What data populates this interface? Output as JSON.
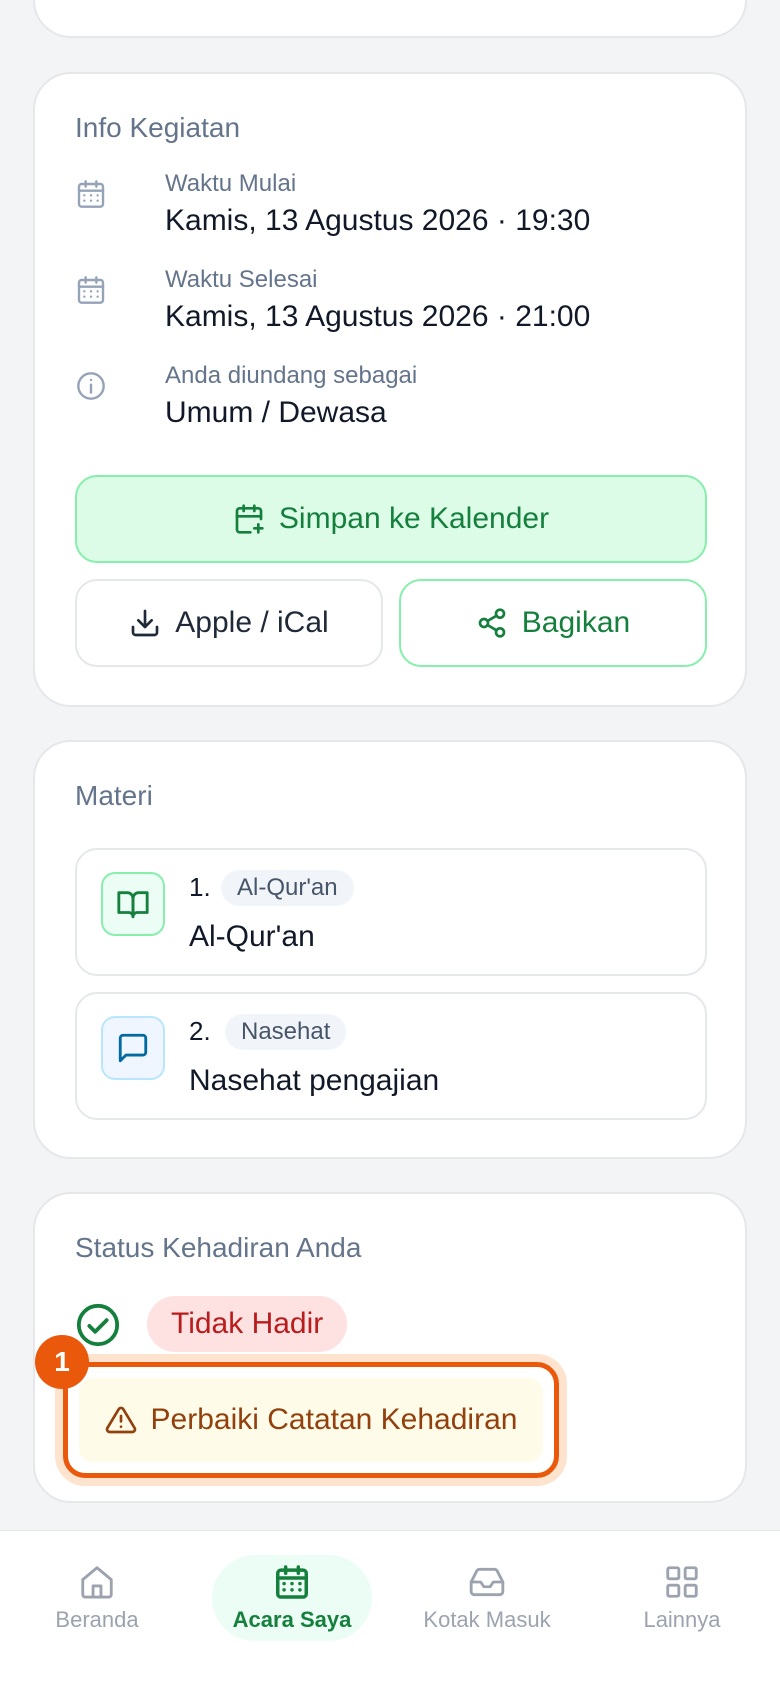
{
  "info": {
    "title": "Info Kegiatan",
    "rows": [
      {
        "label": "Waktu Mulai",
        "value": "Kamis, 13 Agustus 2026 · 19:30",
        "icon": "calendar-icon"
      },
      {
        "label": "Waktu Selesai",
        "value": "Kamis, 13 Agustus 2026 · 21:00",
        "icon": "calendar-icon"
      },
      {
        "label": "Anda diundang sebagai",
        "value": "Umum / Dewasa",
        "icon": "info-icon"
      }
    ],
    "save_calendar_label": "Simpan ke Kalender",
    "ical_label": "Apple / iCal",
    "share_label": "Bagikan"
  },
  "materi": {
    "title": "Materi",
    "items": [
      {
        "number": "1.",
        "tag": "Al-Qur'an",
        "title": "Al-Qur'an",
        "icon": "book-open-icon"
      },
      {
        "number": "2.",
        "tag": "Nasehat",
        "title": "Nasehat pengajian",
        "icon": "message-square-icon"
      }
    ]
  },
  "status": {
    "title": "Status Kehadiran Anda",
    "badge": "Tidak Hadir",
    "fix_label": "Perbaiki Catatan Kehadiran",
    "marker": "1"
  },
  "nav": {
    "items": [
      {
        "label": "Beranda",
        "icon": "home-icon",
        "active": false
      },
      {
        "label": "Acara Saya",
        "icon": "calendar-icon",
        "active": true
      },
      {
        "label": "Kotak Masuk",
        "icon": "inbox-icon",
        "active": false
      },
      {
        "label": "Lainnya",
        "icon": "grid-icon",
        "active": false
      }
    ]
  },
  "colors": {
    "accent_green": "#15803d",
    "danger_red": "#b91c1c",
    "highlight_orange": "#ea580c"
  }
}
